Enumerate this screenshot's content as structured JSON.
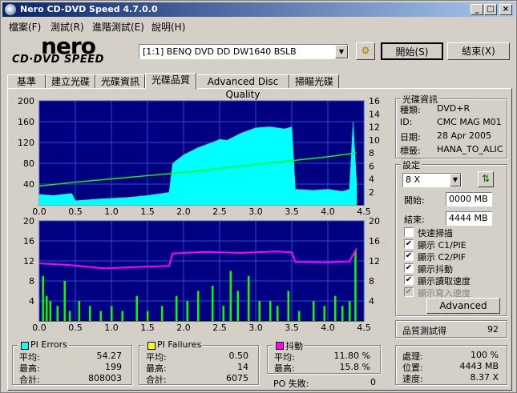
{
  "window": {
    "title": "Nero CD-DVD Speed 4.7.0.0"
  },
  "menu": [
    "檔案(F)",
    "測試(R)",
    "進階測試(E)",
    "說明(H)"
  ],
  "logo": {
    "brand": "nero",
    "subtitle": "CD·DVD SPEED"
  },
  "toolbar": {
    "drive": "[1:1]  BENQ DVD DD DW1640 BSLB",
    "start_label": "開始(S)",
    "exit_label": "結束(X)"
  },
  "tabs": [
    "基準",
    "建立光碟",
    "光碟資訊",
    "光碟品質",
    "Advanced Disc Quality",
    "掃瞄光碟"
  ],
  "active_tab": "光碟品質",
  "disc_info": {
    "title": "光碟資訊",
    "rows": [
      {
        "label": "種類:",
        "value": "DVD+R"
      },
      {
        "label": "ID:",
        "value": "CMC MAG M01"
      },
      {
        "label": "日期:",
        "value": "28 Apr 2005"
      },
      {
        "label": "標籤:",
        "value": "HANA_TO_ALIC"
      }
    ]
  },
  "settings": {
    "title": "設定",
    "speed": "8 X",
    "start_label": "開始:",
    "start_value": "0000 MB",
    "end_label": "結束:",
    "end_value": "4444 MB",
    "options": [
      {
        "label": "快速掃描",
        "checked": false,
        "disabled": false
      },
      {
        "label": "顯示 C1/PIE",
        "checked": true,
        "disabled": false
      },
      {
        "label": "顯示 C2/PIF",
        "checked": true,
        "disabled": false
      },
      {
        "label": "顯示抖動",
        "checked": true,
        "disabled": false
      },
      {
        "label": "顯示讀取速度",
        "checked": true,
        "disabled": false
      },
      {
        "label": "顯示寫入速度",
        "checked": true,
        "disabled": true
      }
    ],
    "advanced_label": "Advanced"
  },
  "quality": {
    "label": "品質測試得",
    "value": "92"
  },
  "pi_errors": {
    "title": "PI Errors",
    "color": "#00ffff",
    "rows": [
      {
        "label": "平均:",
        "value": "54.27"
      },
      {
        "label": "最高:",
        "value": "199"
      },
      {
        "label": "合計:",
        "value": "808003"
      }
    ]
  },
  "pi_failures": {
    "title": "PI Failures",
    "color": "#ffff00",
    "rows": [
      {
        "label": "平均:",
        "value": "0.50"
      },
      {
        "label": "最高:",
        "value": "14"
      },
      {
        "label": "合計:",
        "value": "6075"
      }
    ]
  },
  "jitter": {
    "title": "抖動",
    "color": "#ff00ff",
    "rows": [
      {
        "label": "平均:",
        "value": "11.80 %"
      },
      {
        "label": "最高:",
        "value": "15.8 %"
      }
    ]
  },
  "po": {
    "label": "PO 失敗:",
    "value": "0"
  },
  "progress": {
    "rows": [
      {
        "label": "處理:",
        "value": "100 %"
      },
      {
        "label": "位置:",
        "value": "4443 MB"
      },
      {
        "label": "速度:",
        "value": "8.37 X"
      }
    ]
  },
  "chart_data": [
    {
      "type": "area",
      "x_ticks": [
        "0.0",
        "0.5",
        "1.0",
        "1.5",
        "2.0",
        "2.5",
        "3.0",
        "3.5",
        "4.0",
        "4.5"
      ],
      "y_left_ticks": [
        "200",
        "160",
        "120",
        "80",
        "40"
      ],
      "y_right_ticks": [
        "16",
        "14",
        "12",
        "10",
        "8",
        "6",
        "4",
        "2"
      ],
      "xlim": [
        0,
        4.5
      ],
      "ylim": [
        0,
        200
      ],
      "y2lim": [
        0,
        16
      ],
      "grid": true,
      "series": [
        {
          "color": "#00ffff",
          "x": [
            0,
            0.2,
            0.45,
            0.5,
            0.9,
            1.2,
            1.5,
            1.8,
            1.85,
            2.0,
            2.2,
            2.4,
            2.5,
            2.6,
            2.8,
            3.0,
            3.2,
            3.4,
            3.5,
            3.55,
            3.8,
            4.0,
            4.2,
            4.3,
            4.35,
            4.4
          ],
          "values": [
            20,
            18,
            22,
            8,
            12,
            14,
            18,
            24,
            80,
            96,
            110,
            120,
            126,
            124,
            138,
            148,
            150,
            146,
            150,
            30,
            28,
            30,
            26,
            30,
            160,
            40
          ]
        },
        {
          "color": "#00ff00",
          "x": [
            0,
            0.5,
            1.0,
            1.5,
            2.0,
            2.5,
            3.0,
            3.5,
            4.0,
            4.4
          ],
          "values": [
            2.9,
            3.5,
            4.0,
            4.5,
            5.0,
            5.6,
            6.2,
            6.8,
            7.4,
            8.0
          ]
        }
      ]
    },
    {
      "type": "bar",
      "x_ticks": [
        "0.0",
        "0.5",
        "1.0",
        "1.5",
        "2.0",
        "2.5",
        "3.0",
        "3.5",
        "4.0",
        "4.5"
      ],
      "y_left_ticks": [
        "20",
        "16",
        "12",
        "8",
        "4"
      ],
      "y_right_ticks": [
        "20",
        "16",
        "12",
        "8",
        "4"
      ],
      "xlim": [
        0,
        4.5
      ],
      "ylim": [
        0,
        20
      ],
      "grid": true,
      "series": [
        {
          "color": "#00ff00",
          "x": [
            0.05,
            0.1,
            0.15,
            0.25,
            0.35,
            0.42,
            0.55,
            0.7,
            0.85,
            1.0,
            1.15,
            1.35,
            1.5,
            1.7,
            1.9,
            2.05,
            2.2,
            2.4,
            2.55,
            2.65,
            2.75,
            2.9,
            3.05,
            3.2,
            3.3,
            3.45,
            3.6,
            3.8,
            3.95,
            4.1,
            4.2,
            4.3,
            4.38
          ],
          "values": [
            9,
            5,
            4,
            3,
            8,
            2,
            4,
            3,
            2,
            3,
            2,
            5,
            2,
            3,
            5,
            4,
            6,
            7,
            3,
            10,
            6,
            9,
            4,
            4,
            3,
            6,
            2,
            4,
            3,
            5,
            3,
            4,
            14
          ]
        },
        {
          "color": "#ff00ff",
          "x": [
            0,
            0.4,
            0.9,
            1.4,
            1.8,
            1.85,
            2.3,
            2.8,
            3.3,
            3.5,
            3.55,
            4.0,
            4.3,
            4.4
          ],
          "values": [
            11.5,
            11.2,
            10.5,
            10.8,
            11.0,
            13.5,
            13.8,
            13.6,
            13.9,
            13.7,
            11.8,
            11.7,
            11.9,
            14.5
          ]
        }
      ]
    }
  ]
}
